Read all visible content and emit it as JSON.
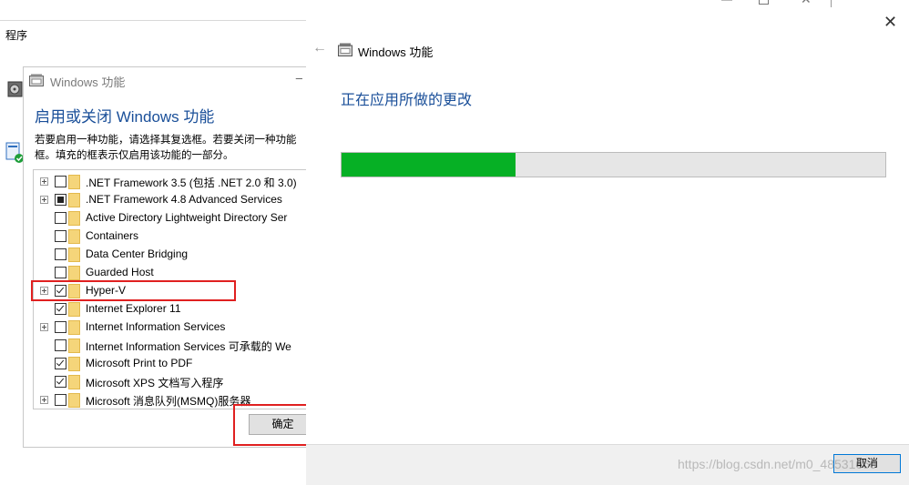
{
  "background_window": {
    "label": "程序"
  },
  "features_dialog": {
    "title": "Windows 功能",
    "minimize_glyph": "–",
    "heading": "启用或关闭 Windows 功能",
    "description": "若要启用一种功能，请选择其复选框。若要关闭一种功能\n框。填充的框表示仅启用该功能的一部分。",
    "items": [
      {
        "label": ".NET Framework 3.5 (包括 .NET 2.0 和 3.0)",
        "expandable": true,
        "state": "unchecked"
      },
      {
        "label": ".NET Framework 4.8 Advanced Services",
        "expandable": true,
        "state": "partial"
      },
      {
        "label": "Active Directory Lightweight Directory Ser",
        "expandable": false,
        "state": "unchecked"
      },
      {
        "label": "Containers",
        "expandable": false,
        "state": "unchecked"
      },
      {
        "label": "Data Center Bridging",
        "expandable": false,
        "state": "unchecked"
      },
      {
        "label": "Guarded Host",
        "expandable": false,
        "state": "unchecked"
      },
      {
        "label": "Hyper-V",
        "expandable": true,
        "state": "checked"
      },
      {
        "label": "Internet Explorer 11",
        "expandable": false,
        "state": "checked"
      },
      {
        "label": "Internet Information Services",
        "expandable": true,
        "state": "unchecked"
      },
      {
        "label": "Internet Information Services 可承载的 We",
        "expandable": false,
        "state": "unchecked"
      },
      {
        "label": "Microsoft Print to PDF",
        "expandable": false,
        "state": "checked"
      },
      {
        "label": "Microsoft XPS 文档写入程序",
        "expandable": false,
        "state": "checked"
      },
      {
        "label": "Microsoft 消息队列(MSMQ)服务器",
        "expandable": true,
        "state": "unchecked"
      }
    ],
    "ok_label": "确定"
  },
  "progress_window": {
    "title": "Windows 功能",
    "back_glyph": "←",
    "close_glyph": "✕",
    "heading": "正在应用所做的更改",
    "progress_fraction": 0.32,
    "cancel_label": "取消"
  },
  "watermark": "https://blog.csdn.net/m0_48531050",
  "colors": {
    "accent_blue": "#1a4f99",
    "progress_green": "#06b025",
    "highlight_red": "#e02020"
  }
}
